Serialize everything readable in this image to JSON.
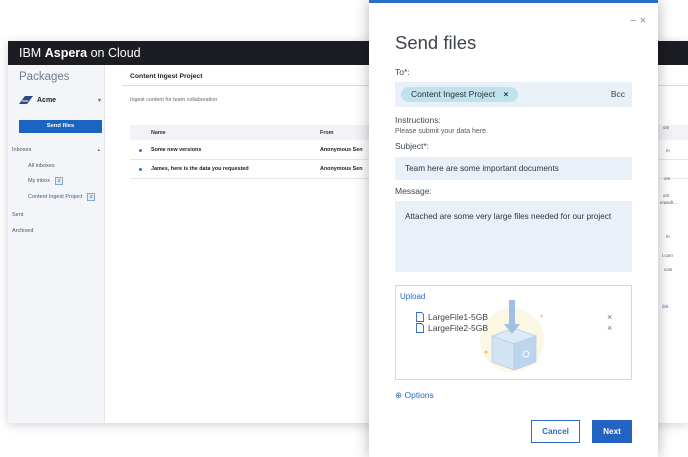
{
  "app": {
    "title_prefix": "IBM",
    "title_brand": "Aspera",
    "title_suffix": "on Cloud"
  },
  "sidebar": {
    "title": "Packages",
    "org_name": "Acme",
    "send_button": "Send files",
    "inboxes_label": "Inboxes",
    "items": [
      {
        "label": "All inboxes",
        "badge": ""
      },
      {
        "label": "My inbox",
        "badge": "3"
      },
      {
        "label": "Content Ingest Project",
        "badge": "2"
      }
    ],
    "sent_label": "Sent",
    "archived_label": "Archived"
  },
  "main": {
    "title": "Content Ingest Project",
    "description": "Ingest content for team collaboration",
    "columns": {
      "name": "Name",
      "from": "From"
    },
    "rows": [
      {
        "name": "Some new versions",
        "from": "Anonymous Sen"
      },
      {
        "name": "James, here is the data you requested",
        "from": "Anonymous Sen"
      }
    ],
    "right_fragments": [
      "om",
      "m",
      "om",
      "om",
      "erasoft...",
      "m",
      "t.com",
      "com",
      "link"
    ]
  },
  "dialog": {
    "title": "Send files",
    "to_label": "To*:",
    "recipient_chip": "Content Ingest Project",
    "chip_remove": "×",
    "bcc": "Bcc",
    "instructions_label": "Instructions:",
    "instructions_text": "Please submit your data here.",
    "subject_label": "Subject*:",
    "subject_value": "Team here are some important documents",
    "message_label": "Message:",
    "message_value": "Attached are some very large files needed for our project",
    "upload_label": "Upload",
    "files": [
      {
        "name": "LargeFile1-5GB"
      },
      {
        "name": "LargeFile2-5GB"
      }
    ],
    "remove_glyph": "×",
    "options_label": "⊕ Options",
    "cancel_button": "Cancel",
    "next_button": "Next",
    "window_controls": "−×"
  },
  "colors": {
    "accent": "#2363c1",
    "chip": "#bfe3ec",
    "field_bg": "#e9f0f8",
    "topbar": "#1b1d22"
  }
}
